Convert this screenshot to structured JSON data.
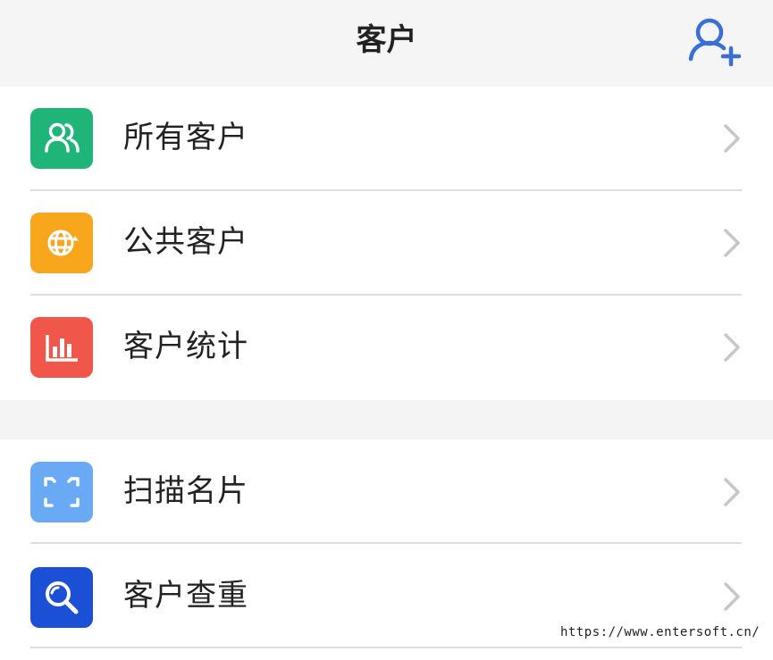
{
  "header": {
    "title": "客户",
    "add_icon": "add-user-icon",
    "accent_color": "#3a6fd8"
  },
  "groups": [
    {
      "items": [
        {
          "label": "所有客户",
          "icon": "people-icon",
          "color": "#1fb579"
        },
        {
          "label": "公共客户",
          "icon": "globe-icon",
          "color": "#f8a71c"
        },
        {
          "label": "客户统计",
          "icon": "bar-chart-icon",
          "color": "#f0564a"
        }
      ]
    },
    {
      "items": [
        {
          "label": "扫描名片",
          "icon": "scan-icon",
          "color": "#6aa9f4"
        },
        {
          "label": "客户查重",
          "icon": "magnifier-icon",
          "color": "#1b4fd6"
        }
      ]
    }
  ],
  "watermark": "https://www.entersoft.cn/"
}
